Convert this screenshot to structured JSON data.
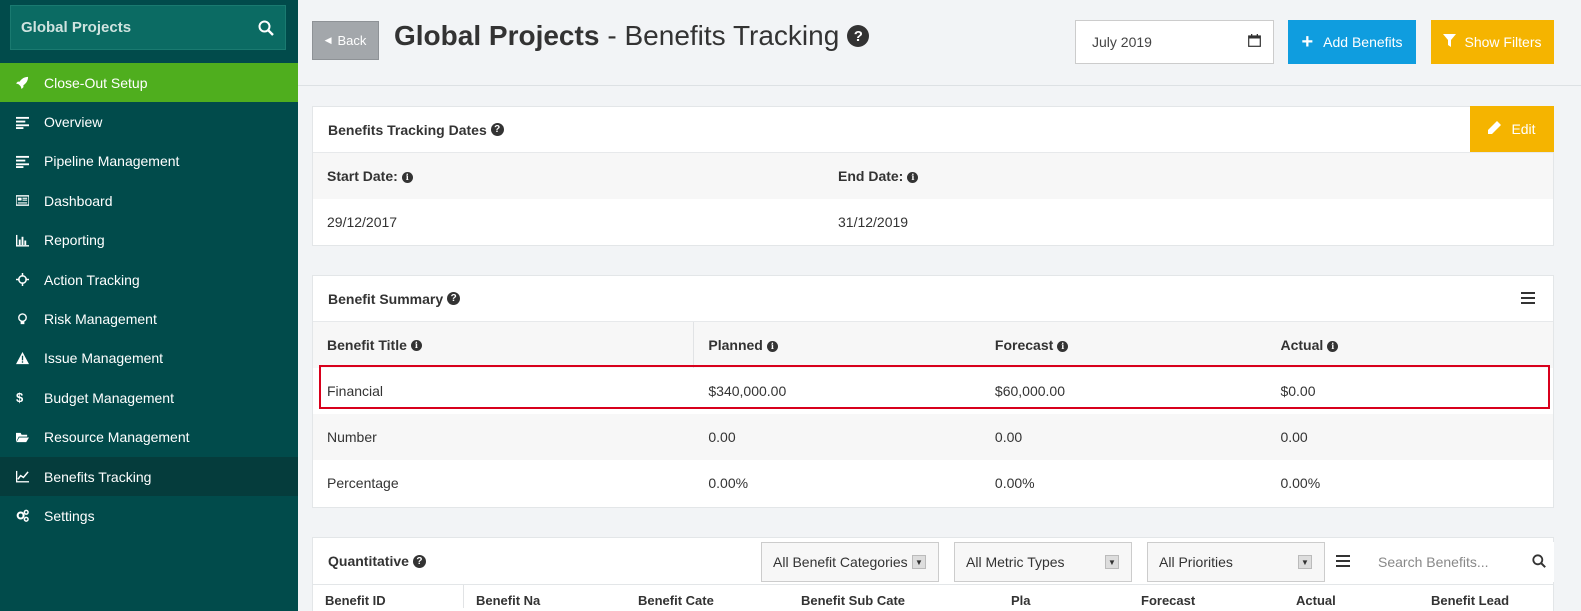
{
  "sidebar": {
    "search_text": "Global Projects",
    "items": [
      {
        "label": "Close-Out Setup",
        "icon": "rocket-icon"
      },
      {
        "label": "Overview",
        "icon": "align-left-icon"
      },
      {
        "label": "Pipeline Management",
        "icon": "align-left-icon"
      },
      {
        "label": "Dashboard",
        "icon": "newspaper-icon"
      },
      {
        "label": "Reporting",
        "icon": "bar-chart-icon"
      },
      {
        "label": "Action Tracking",
        "icon": "crosshairs-icon"
      },
      {
        "label": "Risk Management",
        "icon": "lightbulb-icon"
      },
      {
        "label": "Issue Management",
        "icon": "warning-icon"
      },
      {
        "label": "Budget Management",
        "icon": "dollar-icon"
      },
      {
        "label": "Resource Management",
        "icon": "folder-open-icon"
      },
      {
        "label": "Benefits Tracking",
        "icon": "line-chart-icon"
      },
      {
        "label": "Settings",
        "icon": "gears-icon"
      }
    ]
  },
  "header": {
    "back_label": "Back",
    "title_bold": "Global Projects",
    "title_rest": "- Benefits Tracking",
    "date_value": "July 2019",
    "add_label": "Add Benefits",
    "filter_label": "Show Filters"
  },
  "dates_panel": {
    "title": "Benefits Tracking Dates",
    "edit_label": "Edit",
    "start_label": "Start Date:",
    "end_label": "End Date:",
    "start_value": "29/12/2017",
    "end_value": "31/12/2019"
  },
  "summary_panel": {
    "title": "Benefit Summary",
    "headers": [
      "Benefit Title",
      "Planned",
      "Forecast",
      "Actual"
    ],
    "rows": [
      {
        "title": "Financial",
        "planned": "$340,000.00",
        "forecast": "$60,000.00",
        "actual": "$0.00"
      },
      {
        "title": "Number",
        "planned": "0.00",
        "forecast": "0.00",
        "actual": "0.00"
      },
      {
        "title": "Percentage",
        "planned": "0.00%",
        "forecast": "0.00%",
        "actual": "0.00%"
      }
    ]
  },
  "quant_panel": {
    "title": "Quantitative",
    "categories_select": "All Benefit Categories",
    "metric_select": "All Metric Types",
    "priority_select": "All Priorities",
    "search_placeholder": "Search Benefits...",
    "columns": [
      "Benefit ID",
      "Benefit Na",
      "Benefit Cate",
      "Benefit Sub Cate",
      "Pla",
      "Forecast",
      "Actual",
      "Benefit Lead"
    ]
  },
  "colors": {
    "sidebar_bg": "#014b4b",
    "active_item": "#4fae1e",
    "blue_button": "#0f9ddf",
    "yellow_button": "#f5b400",
    "highlight_border": "#d8001c"
  }
}
